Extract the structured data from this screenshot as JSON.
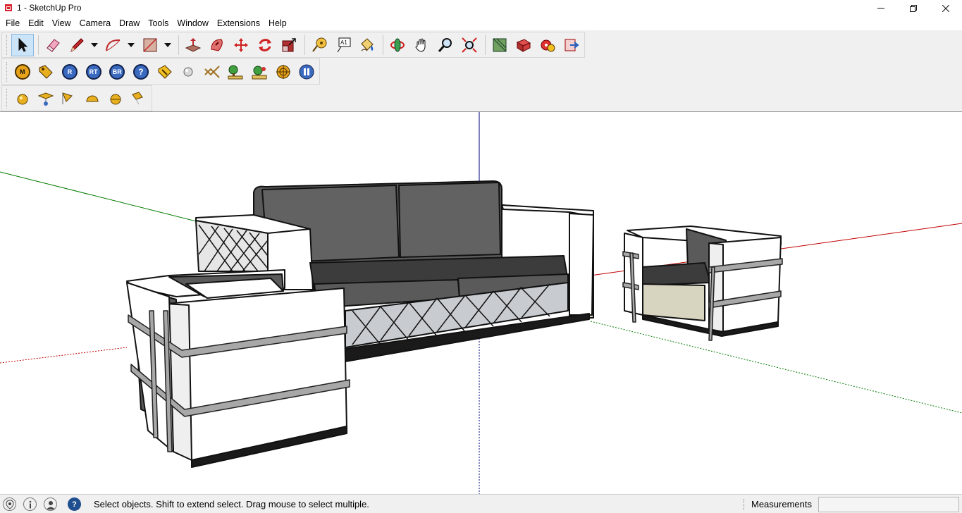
{
  "window": {
    "title": "1 - SketchUp Pro"
  },
  "menu": [
    "File",
    "Edit",
    "View",
    "Camera",
    "Draw",
    "Tools",
    "Window",
    "Extensions",
    "Help"
  ],
  "toolbars": {
    "main": [
      "select-icon",
      "eraser-icon",
      "pencil-icon",
      "arc-icon",
      "rectangle-icon",
      "push-pull-icon",
      "follow-me-icon",
      "move-icon",
      "rotate-icon",
      "scale-icon",
      "tape-measure-icon",
      "text-icon",
      "paint-bucket-icon",
      "orbit-icon",
      "pan-icon",
      "zoom-icon",
      "zoom-extents-icon",
      "warehouse-icon",
      "extension-warehouse-icon",
      "layout-icon",
      "send-to-layout-icon"
    ],
    "render": [
      {
        "icon": "material-icon",
        "label": "M"
      },
      {
        "icon": "tag-icon",
        "label": ""
      },
      {
        "icon": "render-icon",
        "label": "R"
      },
      {
        "icon": "render-rt-icon",
        "label": "RT"
      },
      {
        "icon": "batch-render-icon",
        "label": "BR"
      },
      {
        "icon": "help-icon",
        "label": "?"
      },
      {
        "icon": "light-icon",
        "label": ""
      },
      {
        "icon": "sphere-icon",
        "label": ""
      },
      {
        "icon": "texture-icon",
        "label": ""
      },
      {
        "icon": "tree-icon",
        "label": ""
      },
      {
        "icon": "plant-icon",
        "label": ""
      },
      {
        "icon": "target-icon",
        "label": ""
      },
      {
        "icon": "pause-icon",
        "label": ""
      }
    ],
    "lights": [
      "omni-light-icon",
      "rect-light-icon",
      "spot-light-icon",
      "dome-light-icon",
      "sphere-light-icon",
      "ies-light-icon"
    ]
  },
  "status": {
    "message": "Select objects. Shift to extend select. Drag mouse to select multiple.",
    "measurements_label": "Measurements",
    "measurements_value": ""
  },
  "colors": {
    "axis_red": "#c00000",
    "axis_green": "#007a00",
    "axis_blue": "#00007a",
    "cushion": "#5a5a5a",
    "beige": "#d7d4c0"
  }
}
